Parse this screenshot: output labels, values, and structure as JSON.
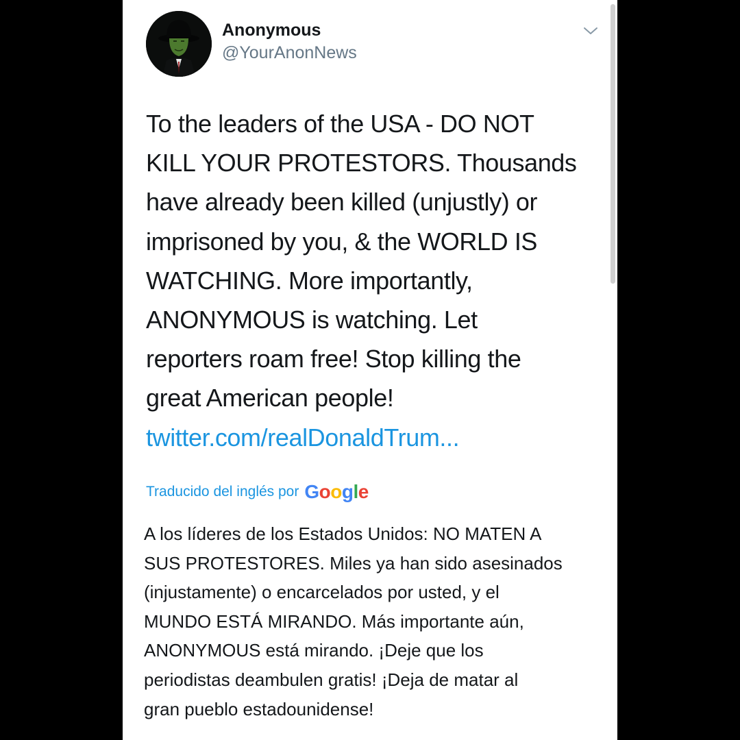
{
  "user": {
    "display_name": "Anonymous",
    "handle": "@YourAnonNews",
    "avatar_icon": "guy-fawkes-avatar-icon"
  },
  "menu_icon": "chevron-down-icon",
  "tweet": {
    "text_lines": [
      "To the leaders of the USA - DO NOT",
      "KILL YOUR PROTESTORS. Thousands",
      "have already been killed (unjustly) or",
      "imprisoned by you, & the WORLD IS",
      "WATCHING. More importantly,",
      "ANONYMOUS is watching. Let",
      "reporters roam free! Stop killing the",
      "great American people!"
    ],
    "link": "twitter.com/realDonaldTrum..."
  },
  "translation": {
    "label": "Traducido del inglés por",
    "provider_letters": [
      "G",
      "o",
      "o",
      "g",
      "l",
      "e"
    ],
    "provider_colors": [
      "#4285F4",
      "#EA4335",
      "#FBBC05",
      "#4285F4",
      "#34A853",
      "#EA4335"
    ],
    "text_lines": [
      "A los líderes de los Estados Unidos: NO MATEN A",
      "SUS PROTESTORES. Miles ya han sido asesinados",
      "(injustamente) o encarcelados por usted, y el",
      "MUNDO ESTÁ MIRANDO. Más importante aún,",
      "ANONYMOUS está mirando. ¡Deje que los",
      "periodistas deambulen gratis! ¡Deja de matar al",
      "gran pueblo estadounidense!"
    ]
  },
  "colors": {
    "link": "#1b95e0",
    "text": "#14171a",
    "secondary": "#657786",
    "background_outer": "#000000",
    "card": "#ffffff"
  }
}
